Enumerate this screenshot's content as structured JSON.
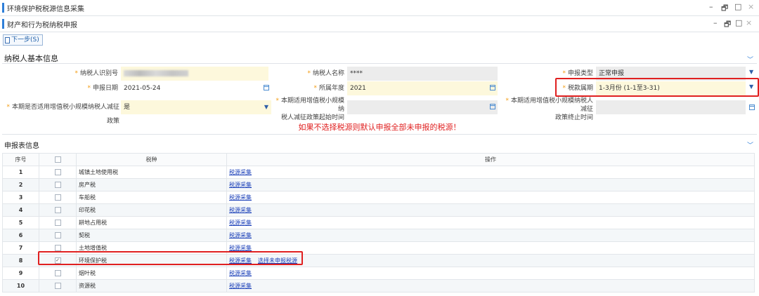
{
  "outer_window": {
    "title": "环境保护税税源信息采集",
    "controls": [
      "–",
      "🗗",
      "□",
      "×"
    ]
  },
  "inner_window": {
    "title": "财产和行为税纳税申报",
    "controls": [
      "–",
      "🗗",
      "□",
      "×"
    ]
  },
  "toolbar": {
    "next_label": "下一步(S)"
  },
  "taxpayer_section": {
    "title": "纳税人基本信息",
    "fields": {
      "taxpayer_id": {
        "label": "纳税人识别号",
        "value": ""
      },
      "taxpayer_name": {
        "label": "纳税人名称",
        "value": "****"
      },
      "declare_type": {
        "label": "申报类型",
        "value": "正常申报"
      },
      "declare_date": {
        "label": "申报日期",
        "value": "2021-05-24"
      },
      "year": {
        "label": "所属年度",
        "value": "2021"
      },
      "tax_period": {
        "label": "税款属期",
        "value": "1-3月份 (1-1至3-31)"
      },
      "small_scale_policy": {
        "label": "本期是否适用增值税小规模纳税人减征政策",
        "value": "是"
      },
      "policy_start": {
        "label_line1": "本期适用增值税小规模纳",
        "label_line2": "税人减征政策起始时间",
        "value": ""
      },
      "policy_end": {
        "label_line1": "本期适用增值税小规模纳税人减征",
        "label_line2": "政策终止时间",
        "value": ""
      }
    }
  },
  "notice": "如果不选择税源则默认申报全部未申报的税源！",
  "declare_section": {
    "title": "申报表信息",
    "columns": {
      "index": "序号",
      "tax_type": "税种",
      "action": "操作"
    },
    "rows": [
      {
        "no": "1",
        "name": "城镇土地使用税",
        "checked": false,
        "links": [
          "税源采集"
        ]
      },
      {
        "no": "2",
        "name": "房产税",
        "checked": false,
        "links": [
          "税源采集"
        ]
      },
      {
        "no": "3",
        "name": "车船税",
        "checked": false,
        "links": [
          "税源采集"
        ]
      },
      {
        "no": "4",
        "name": "印花税",
        "checked": false,
        "links": [
          "税源采集"
        ]
      },
      {
        "no": "5",
        "name": "耕地占用税",
        "checked": false,
        "links": [
          "税源采集"
        ]
      },
      {
        "no": "6",
        "name": "契税",
        "checked": false,
        "links": [
          "税源采集"
        ]
      },
      {
        "no": "7",
        "name": "土地增值税",
        "checked": false,
        "links": [
          "税源采集"
        ]
      },
      {
        "no": "8",
        "name": "环境保护税",
        "checked": true,
        "links": [
          "税源采集",
          "选择未申报税源"
        ]
      },
      {
        "no": "9",
        "name": "烟叶税",
        "checked": false,
        "links": [
          "税源采集"
        ]
      },
      {
        "no": "10",
        "name": "资源税",
        "checked": false,
        "links": [
          "税源采集"
        ]
      }
    ]
  },
  "colors": {
    "accent": "#2f7fd8",
    "highlight": "#e02020",
    "link": "#1a3fb8",
    "required": "#f39c12"
  }
}
